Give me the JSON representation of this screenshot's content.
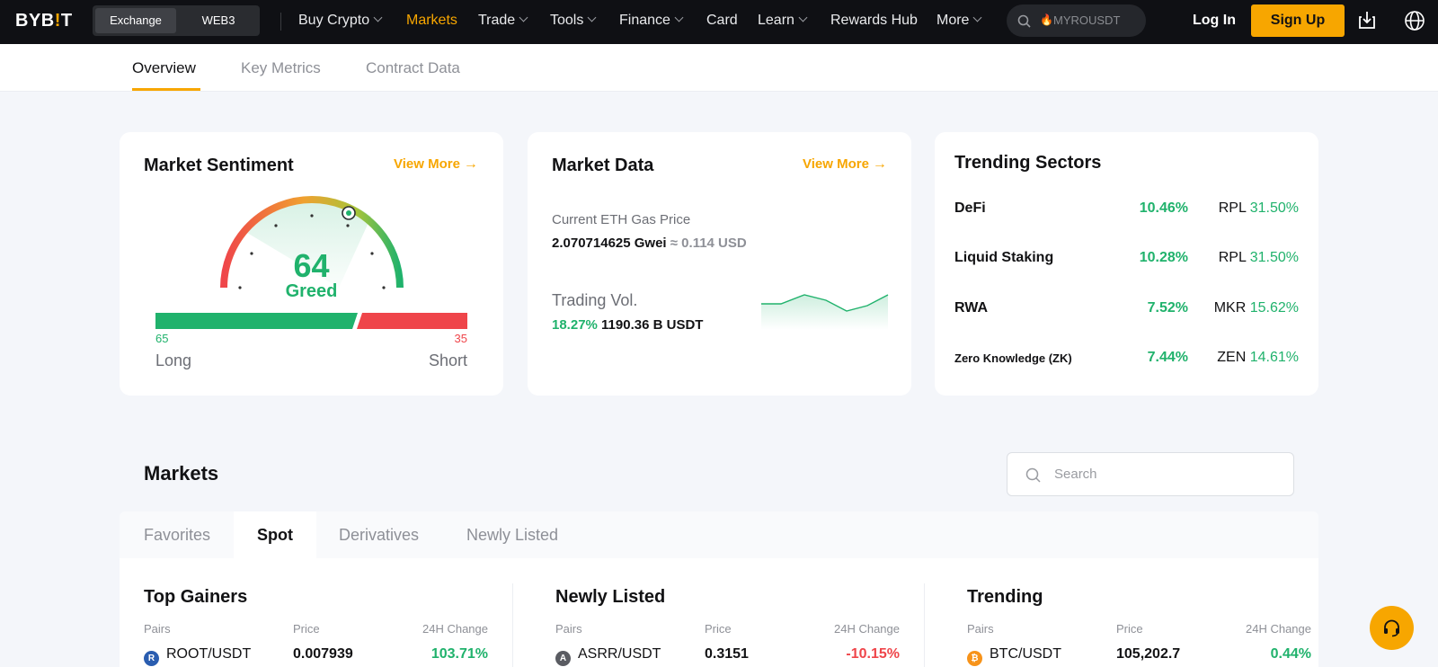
{
  "brand": {
    "logo_main": "BYB",
    "logo_bang": "!",
    "logo_end": "T"
  },
  "nav": {
    "segment": [
      "Exchange",
      "WEB3"
    ],
    "items": [
      {
        "label": "Buy Crypto",
        "dropdown": true
      },
      {
        "label": "Markets",
        "dropdown": false,
        "active": true
      },
      {
        "label": "Trade",
        "dropdown": true
      },
      {
        "label": "Tools",
        "dropdown": true
      },
      {
        "label": "Finance",
        "dropdown": true
      },
      {
        "label": "Card",
        "dropdown": false
      },
      {
        "label": "Learn",
        "dropdown": true
      },
      {
        "label": "Rewards Hub",
        "dropdown": false
      },
      {
        "label": "More",
        "dropdown": true
      }
    ],
    "search_placeholder": "MYROUSDT",
    "login": "Log In",
    "signup": "Sign Up"
  },
  "subtabs": [
    "Overview",
    "Key Metrics",
    "Contract Data"
  ],
  "sentiment": {
    "title": "Market Sentiment",
    "view_more": "View More",
    "value": "64",
    "label": "Greed",
    "long_pct": "65",
    "short_pct": "35",
    "long_label": "Long",
    "short_label": "Short"
  },
  "market_data": {
    "title": "Market Data",
    "view_more": "View More",
    "gas_label": "Current ETH Gas Price",
    "gas_value": "2.070714625 Gwei",
    "gas_usd": "≈ 0.114 USD",
    "vol_label": "Trading Vol.",
    "vol_change": "18.27%",
    "vol_value": "1190.36 B USDT"
  },
  "trending_sectors": {
    "title": "Trending Sectors",
    "rows": [
      {
        "name": "DeFi",
        "pct": "10.46%",
        "coin": "RPL",
        "coin_pct": "31.50%"
      },
      {
        "name": "Liquid Staking",
        "pct": "10.28%",
        "coin": "RPL",
        "coin_pct": "31.50%"
      },
      {
        "name": "RWA",
        "pct": "7.52%",
        "coin": "MKR",
        "coin_pct": "15.62%"
      },
      {
        "name": "Zero Knowledge (ZK)",
        "pct": "7.44%",
        "coin": "ZEN",
        "coin_pct": "14.61%"
      }
    ]
  },
  "markets": {
    "title": "Markets",
    "search_placeholder": "Search",
    "tabs": [
      "Favorites",
      "Spot",
      "Derivatives",
      "Newly Listed"
    ],
    "headers": {
      "pairs": "Pairs",
      "price": "Price",
      "change": "24H Change"
    },
    "columns": [
      {
        "title": "Top Gainers",
        "pair": "ROOT/USDT",
        "price": "0.007939",
        "change": "103.71%",
        "dir": "up",
        "coin_color": "#2a5db0",
        "coin_glyph": "R"
      },
      {
        "title": "Newly Listed",
        "pair": "ASRR/USDT",
        "price": "0.3151",
        "change": "-10.15%",
        "dir": "down",
        "coin_color": "#5a5c62",
        "coin_glyph": "A"
      },
      {
        "title": "Trending",
        "pair": "BTC/USDT",
        "price": "105,202.7",
        "change": "0.44%",
        "dir": "up",
        "coin_color": "#f7931a",
        "coin_glyph": "₿"
      }
    ]
  },
  "colors": {
    "accent": "#f7a600",
    "up": "#20b26c",
    "down": "#ef454a",
    "nav_bg": "#0f1014"
  }
}
